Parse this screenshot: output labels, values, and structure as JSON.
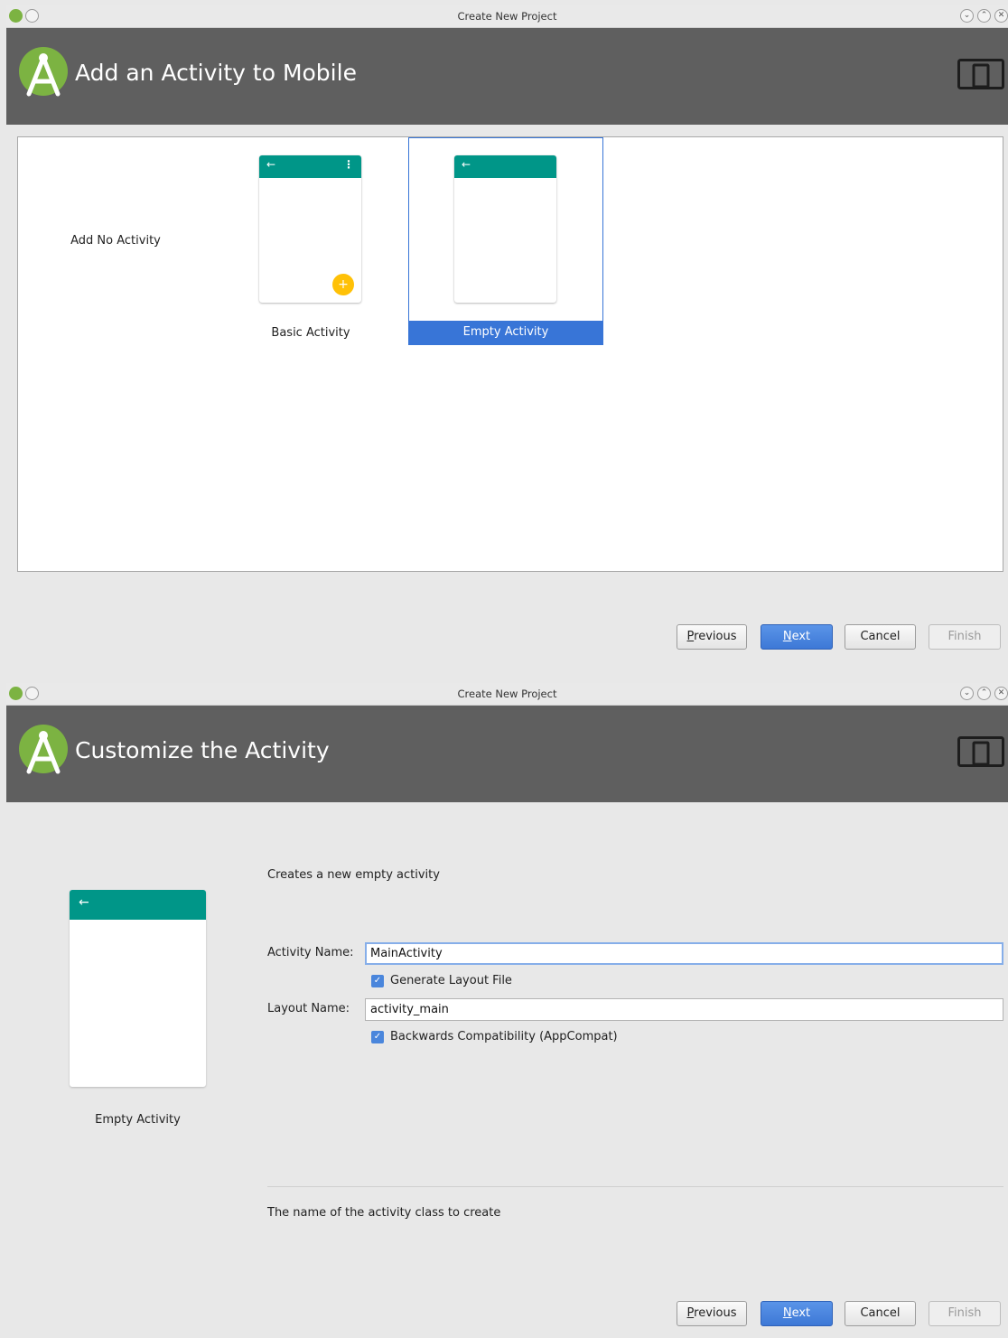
{
  "window1": {
    "title": "Create New Project",
    "heading": "Add an Activity to Mobile",
    "tiles": {
      "none_label": "Add No Activity",
      "basic_label": "Basic Activity",
      "empty_label": "Empty Activity"
    },
    "buttons": {
      "previous_mn": "P",
      "previous_rest": "revious",
      "next_mn": "N",
      "next_rest": "ext",
      "cancel": "Cancel",
      "finish": "Finish"
    }
  },
  "window2": {
    "title": "Create New Project",
    "heading": "Customize the Activity",
    "description": "Creates a new empty activity",
    "preview_label": "Empty Activity",
    "activity_name_label": "Activity Name:",
    "activity_name_value": "MainActivity",
    "generate_layout_label": "Generate Layout File",
    "layout_name_label": "Layout Name:",
    "layout_name_value": "activity_main",
    "backwards_compat_label": "Backwards Compatibility (AppCompat)",
    "help_text": "The name of the activity class to create",
    "buttons": {
      "previous_mn": "P",
      "previous_rest": "revious",
      "next_mn": "N",
      "next_rest": "ext",
      "cancel": "Cancel",
      "finish": "Finish"
    }
  },
  "icons": {
    "back_arrow": "←",
    "overflow_menu": "⋮",
    "fab_plus": "+",
    "check": "✓",
    "minimize": "⌄",
    "maximize": "⌃",
    "close": "✕"
  },
  "colors": {
    "banner": "#5f5f5f",
    "app_bar": "#009688",
    "fab": "#ffc107",
    "selection": "#3875d7",
    "android_green": "#7cb342"
  }
}
